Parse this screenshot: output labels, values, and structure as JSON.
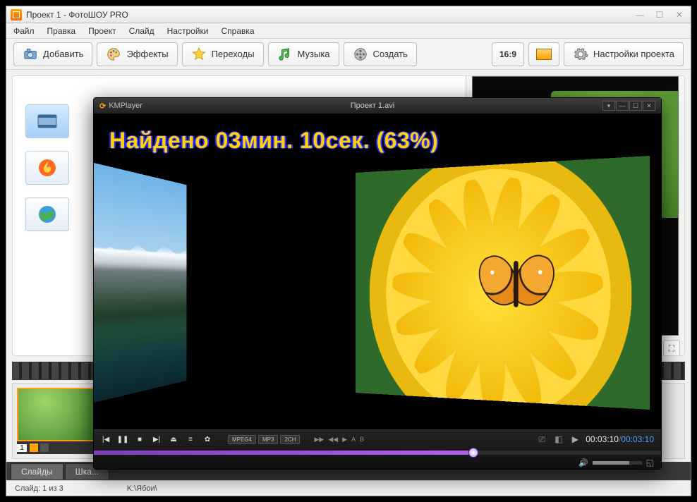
{
  "window": {
    "title": "Проект 1 - ФотоШОУ PRO"
  },
  "menu": [
    "Файл",
    "Правка",
    "Проект",
    "Слайд",
    "Настройки",
    "Справка"
  ],
  "toolbar": {
    "add": "Добавить",
    "effects": "Эффекты",
    "transitions": "Переходы",
    "music": "Музыка",
    "create": "Создать",
    "aspect": "16:9",
    "settings": "Настройки проекта"
  },
  "timeline": {
    "slide1_num": "1"
  },
  "tabs": {
    "slides": "Слайды",
    "scale": "Шка..."
  },
  "status": {
    "slide": "Слайд: 1 из 3",
    "path": "K:\\Ябои\\"
  },
  "kmp": {
    "app": "KMPlayer",
    "file": "Проект 1.avi",
    "overlay": "Найдено 03мин. 10сек. (63%)",
    "badges": [
      "MPEG4",
      "MP3",
      "2CH"
    ],
    "tiny": [
      "▶▶",
      "◀◀",
      "▶",
      "A",
      "B"
    ],
    "time_cur": "00:03:10",
    "time_tot": "00:03:10",
    "play_symbol": "▶"
  }
}
